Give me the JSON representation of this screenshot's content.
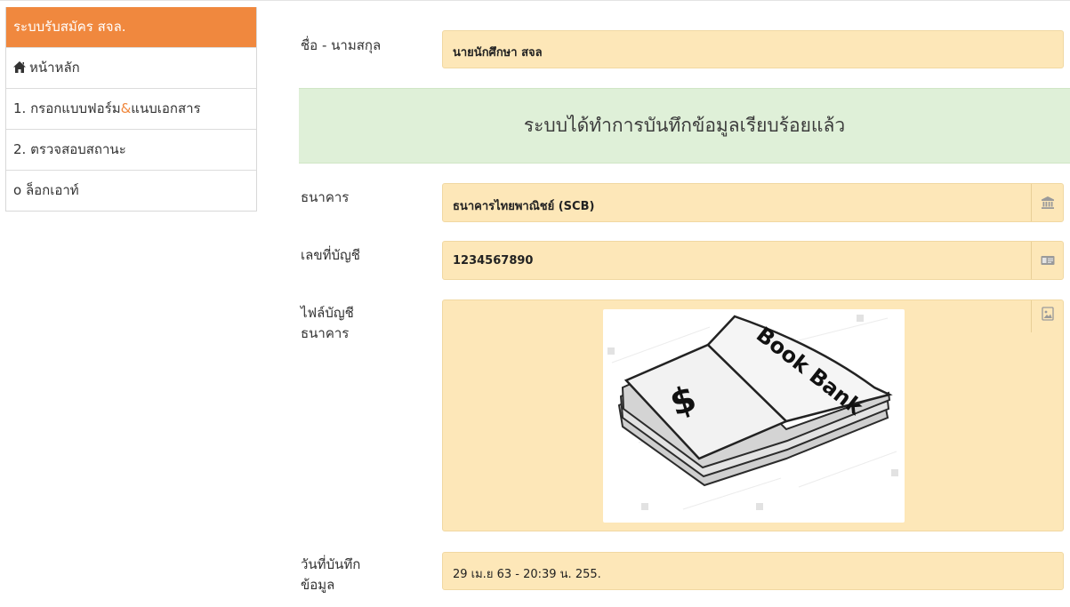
{
  "sidebar": {
    "header": "ระบบรับสมัคร สจล.",
    "items": [
      {
        "label": "หน้าหลัก",
        "icon": "home-icon"
      },
      {
        "label_before": "1. กรอกแบบฟอร์ม",
        "label_amp": "&",
        "label_after": "แนบเอกสาร"
      },
      {
        "label": "2. ตรวจสอบสถานะ"
      },
      {
        "label": "o ล็อกเอาท์"
      }
    ]
  },
  "form": {
    "name_label": "ชื่อ - นามสกุล",
    "name_value": "นายนักศึกษา สจล",
    "success_message": "ระบบได้ทำการบันทึกข้อมูลเรียบร้อยแล้ว",
    "bank_label": "ธนาคาร",
    "bank_value": "ธนาคารไทยพาณิชย์ (SCB)",
    "bank_icon": "bank-icon",
    "account_label": "เลขที่บัญชี",
    "account_value": "1234567890",
    "account_icon": "id-card-icon",
    "file_label_line1": "ไฟล์บัญชี",
    "file_label_line2": "ธนาคาร",
    "file_icon": "image-icon",
    "book_bank_text": "Book Bank",
    "book_symbol": "$",
    "date_label_line1": "วันที่บันทึก",
    "date_label_line2": "ข้อมูล",
    "date_value": "29 เม.ย 63 - 20:39 น. 255."
  },
  "colors": {
    "accent": "#f0883e",
    "field_bg": "#fde7b8",
    "success_bg": "#dff0d8"
  }
}
